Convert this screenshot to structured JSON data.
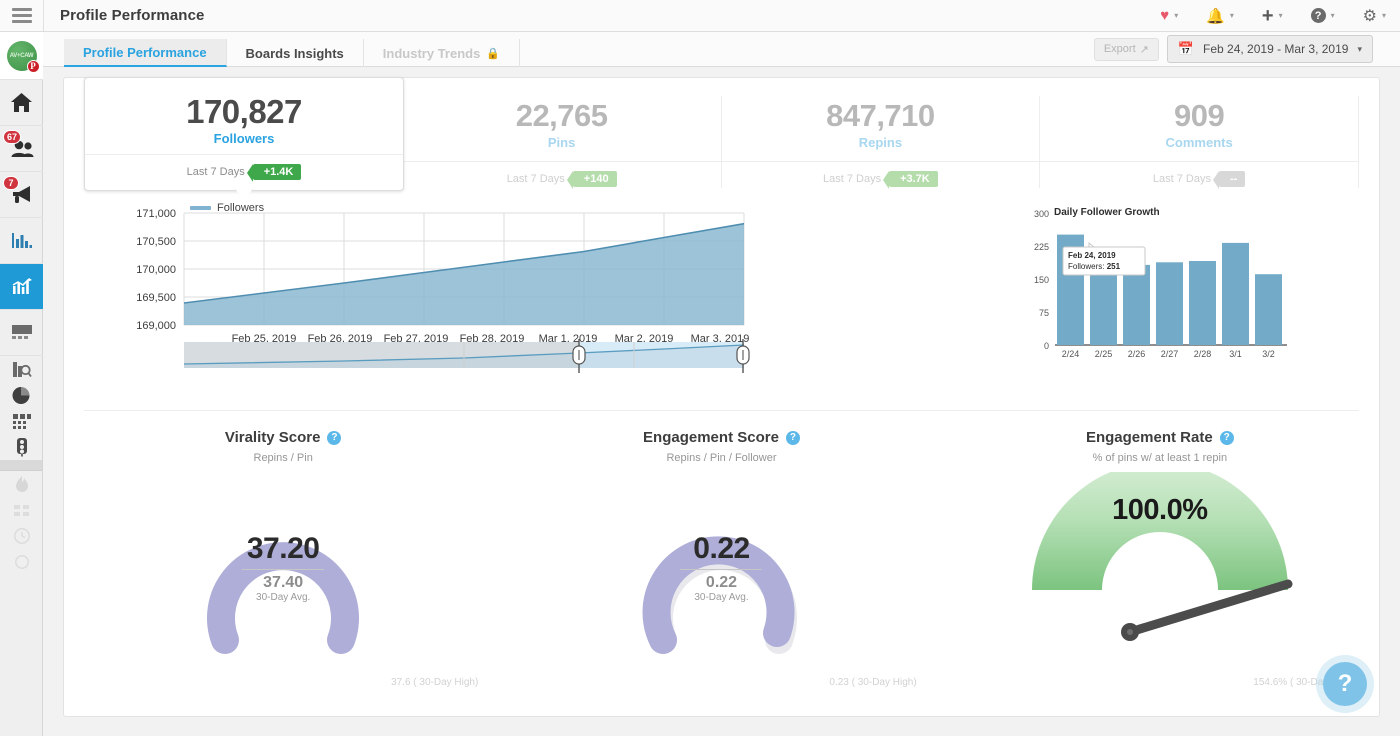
{
  "app": {
    "title": "Profile Performance",
    "menu_icon": "hamburger-icon"
  },
  "topbar": {
    "items": [
      {
        "name": "favorites",
        "icon": "heart-icon"
      },
      {
        "name": "notifications",
        "icon": "bell-icon"
      },
      {
        "name": "create",
        "icon": "plus-icon"
      },
      {
        "name": "help",
        "icon": "question-icon"
      },
      {
        "name": "settings",
        "icon": "gear-icon"
      }
    ],
    "caret": "▾"
  },
  "sidebar": {
    "avatar_text": "AV+CAW",
    "pin_badge": "P",
    "items": [
      {
        "name": "home",
        "icon": "home-icon",
        "badge": null
      },
      {
        "name": "audience",
        "icon": "people-icon",
        "badge": "67"
      },
      {
        "name": "promote",
        "icon": "megaphone-icon",
        "badge": "7"
      },
      {
        "name": "reports",
        "icon": "bar-chart-icon",
        "badge": null
      },
      {
        "name": "analytics",
        "icon": "line-chart-icon",
        "badge": null,
        "active": true
      },
      {
        "name": "boards",
        "icon": "card-icon",
        "badge": null
      },
      {
        "name": "inspect",
        "icon": "magnify-doc-icon",
        "badge": null
      },
      {
        "name": "pie",
        "icon": "pie-chart-icon",
        "badge": null
      },
      {
        "name": "grid",
        "icon": "grid-icon",
        "badge": null
      },
      {
        "name": "signals",
        "icon": "traffic-light-icon",
        "badge": null
      },
      {
        "name": "trending",
        "icon": "flame-icon",
        "badge": null
      },
      {
        "name": "compare",
        "icon": "compare-icon",
        "badge": null
      },
      {
        "name": "history",
        "icon": "clock-icon",
        "badge": null
      },
      {
        "name": "refresh",
        "icon": "circle-icon",
        "badge": null
      }
    ]
  },
  "tabs": [
    {
      "label": "Profile Performance",
      "active": true,
      "locked": false
    },
    {
      "label": "Boards Insights",
      "active": false,
      "locked": false
    },
    {
      "label": "Industry Trends",
      "active": false,
      "locked": true
    }
  ],
  "toolbar": {
    "export_label": "Export",
    "export_icon": "external-link-icon",
    "calendar_icon": "calendar-icon",
    "date_range": "Feb 24, 2019 - Mar 3, 2019",
    "caret": "▾"
  },
  "kpis": [
    {
      "value": "170,827",
      "label": "Followers",
      "period": "Last 7 Days",
      "delta": "+1.4K",
      "selected": true
    },
    {
      "value": "22,765",
      "label": "Pins",
      "period": "Last 7 Days",
      "delta": "+140",
      "selected": false
    },
    {
      "value": "847,710",
      "label": "Repins",
      "period": "Last 7 Days",
      "delta": "+3.7K",
      "selected": false
    },
    {
      "value": "909",
      "label": "Comments",
      "period": "Last 7 Days",
      "delta": "--",
      "selected": false
    }
  ],
  "chart_data": [
    {
      "type": "area",
      "title": "",
      "legend": [
        "Followers"
      ],
      "legend_position": "top-left",
      "x": [
        "Feb 24, 2019",
        "Feb 25, 2019",
        "Feb 26, 2019",
        "Feb 27, 2019",
        "Feb 28, 2019",
        "Mar 1, 2019",
        "Mar 2, 2019",
        "Mar 3, 2019"
      ],
      "xtick_labels": [
        "Feb 25, 2019",
        "Feb 26, 2019",
        "Feb 27, 2019",
        "Feb 28, 2019",
        "Mar 1, 2019",
        "Mar 2, 2019",
        "Mar 3, 2019"
      ],
      "series": [
        {
          "name": "Followers",
          "values": [
            169400,
            169580,
            169760,
            169950,
            170140,
            170330,
            170580,
            170827
          ],
          "color": "#7fb3cf"
        }
      ],
      "ytick_labels": [
        "169,000",
        "169,500",
        "170,000",
        "170,500",
        "171,000"
      ],
      "ylim": [
        169000,
        171000
      ],
      "ylabel": "",
      "xlabel": "",
      "grid": true,
      "navigator": true
    },
    {
      "type": "bar",
      "title": "Daily Follower Growth",
      "categories": [
        "2/24",
        "2/25",
        "2/26",
        "2/27",
        "2/28",
        "3/1",
        "3/2"
      ],
      "values": [
        251,
        178,
        182,
        188,
        191,
        232,
        161
      ],
      "ytick_labels": [
        "0",
        "75",
        "150",
        "225",
        "300"
      ],
      "ylim": [
        0,
        300
      ],
      "xlabel": "",
      "ylabel": "",
      "grid": false,
      "bar_color": "#72aac8",
      "tooltip": {
        "title": "Feb 24, 2019",
        "label": "Followers:",
        "value": "251"
      }
    }
  ],
  "gauges": [
    {
      "title": "Virality Score",
      "subtitle": "Repins / Pin",
      "value": "37.20",
      "avg_value": "37.40",
      "avg_label": "30-Day Avg.",
      "footer": "37.6 ( 30-Day High)",
      "help_icon": "question-icon",
      "style": "donut",
      "color": "#aeaed8",
      "fill_pct": 99
    },
    {
      "title": "Engagement Score",
      "subtitle": "Repins / Pin / Follower",
      "value": "0.22",
      "avg_value": "0.22",
      "avg_label": "30-Day Avg.",
      "footer": "0.23 ( 30-Day High)",
      "help_icon": "question-icon",
      "style": "donut",
      "color": "#aeaed8",
      "fill_pct": 94
    },
    {
      "title": "Engagement Rate",
      "subtitle": "% of pins w/ at least 1 repin",
      "value": "100.0%",
      "footer": "154.6% ( 30-Day High)",
      "help_icon": "question-icon",
      "style": "needle",
      "color": "#9ed6a0",
      "needle_pct": 100
    }
  ],
  "help_fab": {
    "icon": "question-icon",
    "label": "?"
  }
}
